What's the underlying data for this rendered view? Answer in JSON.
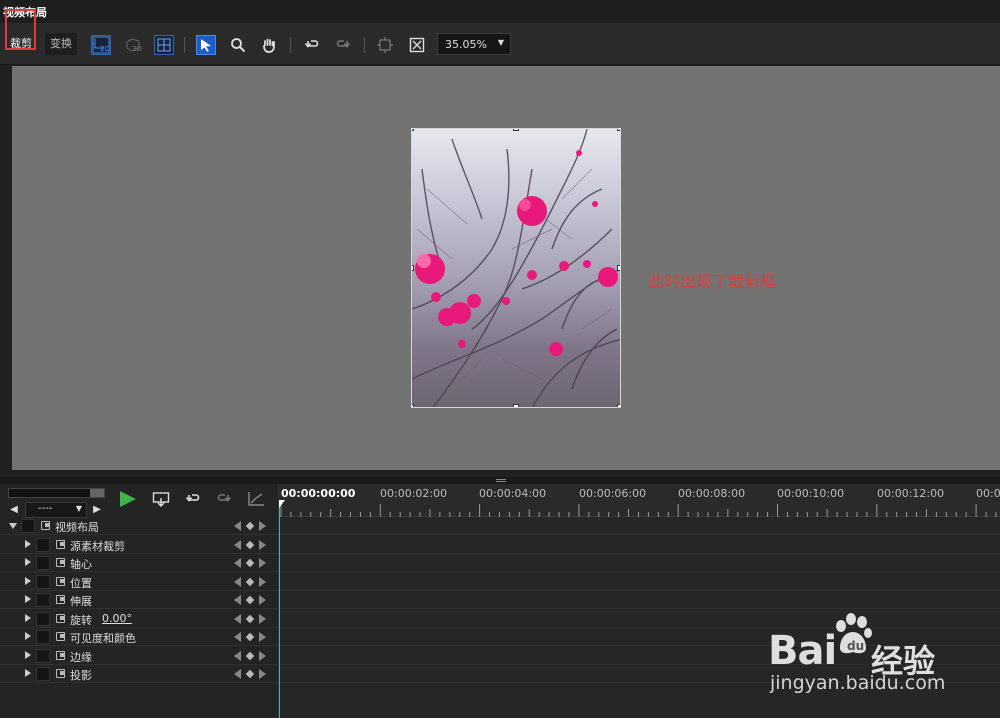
{
  "window": {
    "title": "视频布局"
  },
  "toolbar": {
    "crop_tab": "裁剪",
    "transform_tab": "变换",
    "zoom_value": "35.05%",
    "icons": [
      "2d-mode-icon",
      "3d-mode-icon",
      "grid-icon",
      "select-arrow-icon",
      "zoom-icon",
      "hand-icon",
      "undo-icon",
      "redo-icon",
      "fit-frame-icon",
      "fit-screen-icon"
    ]
  },
  "preview": {
    "annotation": "此时出现了裁剪框",
    "image_subject": "pink plum blossoms"
  },
  "keyframe_nav": {
    "select_value": "----"
  },
  "timeline": {
    "current_timecode": "00:00:00:00",
    "ruler_labels": [
      "00:00:02:00",
      "00:00:04:00",
      "00:00:06:00",
      "00:00:08:00",
      "00:00:10:00",
      "00:00:12:00",
      "00:0"
    ]
  },
  "tracks": [
    {
      "label": "视频布局",
      "level": 0,
      "expanded": true
    },
    {
      "label": "源素材裁剪",
      "level": 1
    },
    {
      "label": "轴心",
      "level": 1
    },
    {
      "label": "位置",
      "level": 1
    },
    {
      "label": "伸展",
      "level": 1
    },
    {
      "label": "旋转",
      "level": 1,
      "value": "0.00°"
    },
    {
      "label": "可见度和颜色",
      "level": 1
    },
    {
      "label": "边缘",
      "level": 1
    },
    {
      "label": "投影",
      "level": 1
    }
  ],
  "watermark": {
    "brand": "Bai",
    "brand_cn": "经验",
    "url": "jingyan.baidu.com"
  },
  "colors": {
    "accent_blue": "#1c5ec9",
    "highlight_red": "#e23b3b",
    "playhead": "#3fb3b3",
    "play_green": "#3fb34a"
  }
}
